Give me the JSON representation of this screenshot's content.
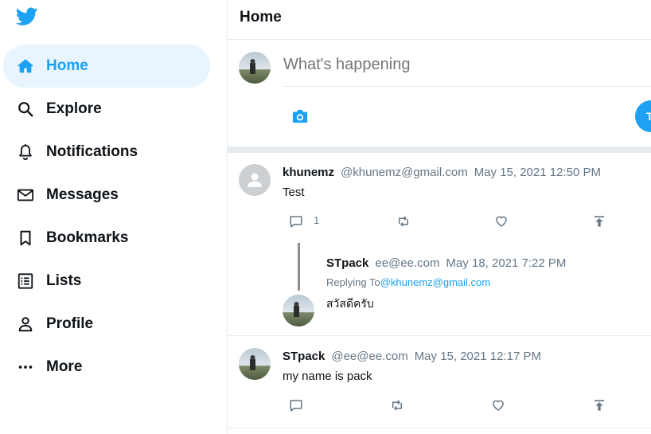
{
  "nav": {
    "items": [
      {
        "label": "Home",
        "icon": "home-icon",
        "active": true
      },
      {
        "label": "Explore",
        "icon": "search-icon"
      },
      {
        "label": "Notifications",
        "icon": "bell-icon"
      },
      {
        "label": "Messages",
        "icon": "mail-icon"
      },
      {
        "label": "Bookmarks",
        "icon": "bookmark-icon"
      },
      {
        "label": "Lists",
        "icon": "list-icon"
      },
      {
        "label": "Profile",
        "icon": "person-icon"
      },
      {
        "label": "More",
        "icon": "more-icon"
      }
    ]
  },
  "header": {
    "title": "Home"
  },
  "compose": {
    "placeholder": "What's happening",
    "tweet_button": "T"
  },
  "tweets": [
    {
      "name": "khunemz",
      "handle": "@khunemz@gmail.com",
      "date": "May 15, 2021 12:50 PM",
      "text": "Test",
      "reply_count": "1",
      "reply": {
        "name": "STpack",
        "handle": "ee@ee.com",
        "date": "May 18, 2021 7:22 PM",
        "replying_to_label": "Replying To",
        "replying_to": "@khunemz@gmail.com",
        "text": "สวัสดีครับ"
      }
    },
    {
      "name": "STpack",
      "handle": "@ee@ee.com",
      "date": "May 15, 2021 12:17 PM",
      "text": "my name is pack"
    }
  ],
  "colors": {
    "accent": "#1da1f2",
    "active_bg": "#e8f5fe",
    "border": "#e6ecf0",
    "muted": "#657786"
  }
}
